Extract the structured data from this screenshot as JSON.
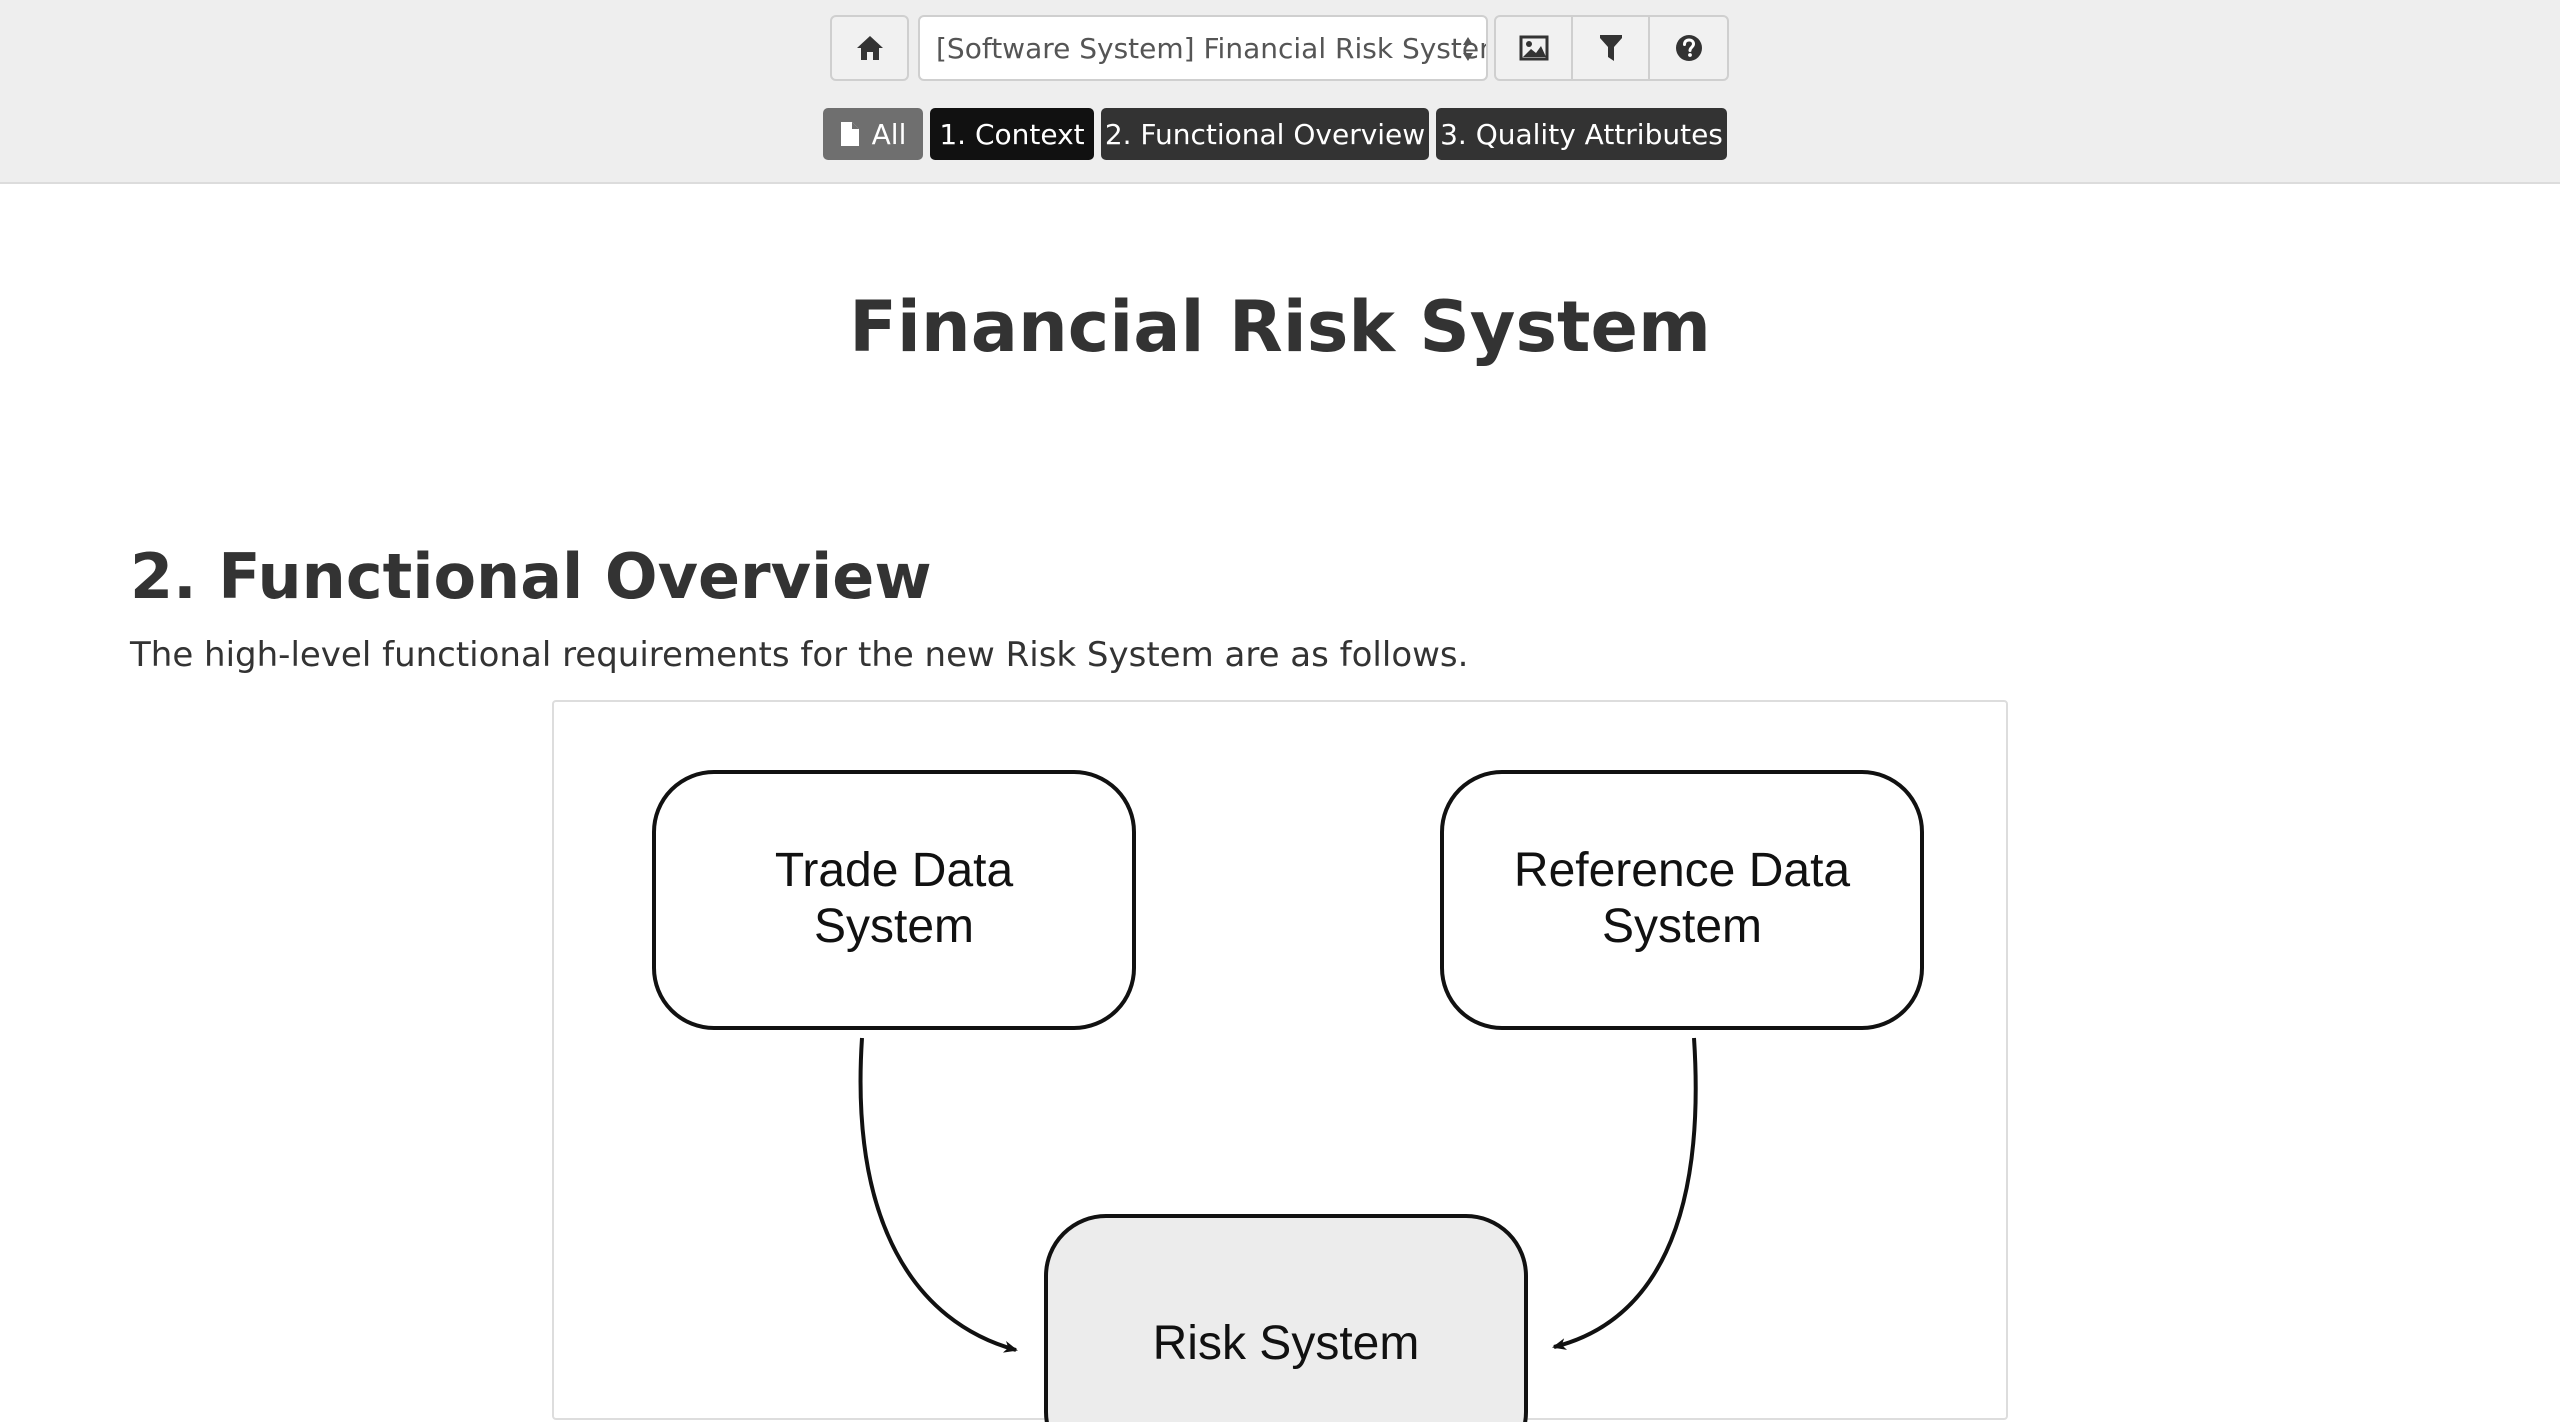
{
  "toolbar": {
    "home_icon": "home-icon",
    "selector_value": "[Software System] Financial Risk System",
    "image_icon": "image-icon",
    "filter_icon": "filter-icon",
    "help_icon": "help-icon"
  },
  "tabs": [
    {
      "label": "All",
      "icon": "document-icon"
    },
    {
      "label": "1. Context"
    },
    {
      "label": "2. Functional Overview"
    },
    {
      "label": "3. Quality Attributes"
    }
  ],
  "page": {
    "title": "Financial Risk System"
  },
  "section": {
    "heading": "2. Functional Overview",
    "intro": "The high-level functional requirements for the new Risk System are as follows."
  },
  "diagram": {
    "nodes": [
      {
        "line1": "Trade Data",
        "line2": "System"
      },
      {
        "line1": "Reference Data",
        "line2": "System"
      },
      {
        "line1": "Risk System"
      }
    ],
    "colors": {
      "node_fill": "#ffffff",
      "target_fill": "#ececec",
      "stroke": "#111111"
    }
  }
}
